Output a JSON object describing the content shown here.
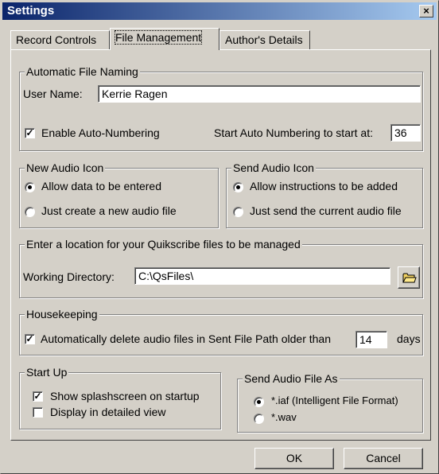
{
  "window": {
    "title": "Settings",
    "close_label": "×"
  },
  "tabs": [
    {
      "label": "Record Controls"
    },
    {
      "label": "File Management"
    },
    {
      "label": "Author's Details"
    }
  ],
  "file_naming": {
    "legend": "Automatic File Naming",
    "user_name_label": "User Name:",
    "user_name_value": "Kerrie Ragen",
    "enable_auto_numbering_label": "Enable Auto-Numbering",
    "enable_auto_numbering_checked": true,
    "start_label": "Start Auto Numbering to start at:",
    "start_value": "36"
  },
  "new_audio_icon": {
    "legend": "New Audio Icon",
    "options": [
      {
        "label": "Allow data to be entered",
        "selected": true
      },
      {
        "label": "Just create a new audio file",
        "selected": false
      }
    ]
  },
  "send_audio_icon": {
    "legend": "Send Audio Icon",
    "options": [
      {
        "label": "Allow instructions to be added",
        "selected": true
      },
      {
        "label": "Just send the current audio file",
        "selected": false
      }
    ]
  },
  "location": {
    "legend": "Enter a location for your Quikscribe files to be managed",
    "working_dir_label": "Working Directory:",
    "working_dir_value": "C:\\QsFiles\\",
    "browse_icon": "folder-icon"
  },
  "housekeeping": {
    "legend": "Housekeeping",
    "delete_label": "Automatically delete audio files in Sent File Path older than",
    "delete_checked": true,
    "days_value": "14",
    "days_label": "days"
  },
  "start_up": {
    "legend": "Start Up",
    "splash_label": "Show splashscreen on startup",
    "splash_checked": true,
    "detailed_label": "Display in detailed view",
    "detailed_checked": false
  },
  "send_as": {
    "legend": "Send Audio File As",
    "options": [
      {
        "label": "*.iaf  (Intelligent File Format)",
        "selected": true
      },
      {
        "label": "*.wav",
        "selected": false
      }
    ]
  },
  "footer": {
    "ok_label": "OK",
    "cancel_label": "Cancel"
  },
  "colors": {
    "titlebar_start": "#0a246a",
    "titlebar_end": "#a6caf0",
    "face": "#d4d0c8"
  }
}
